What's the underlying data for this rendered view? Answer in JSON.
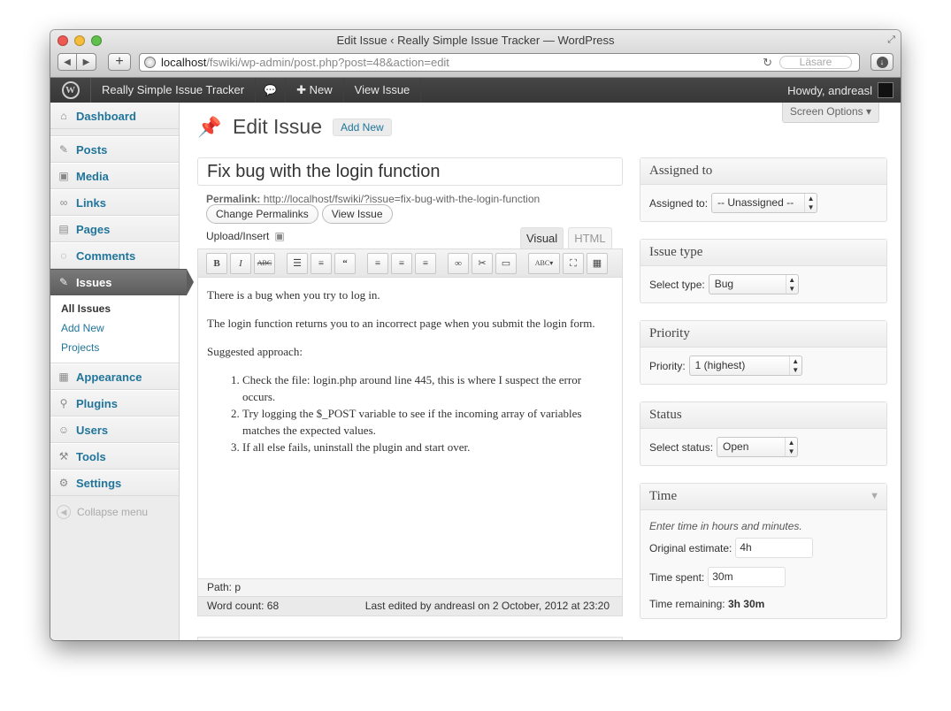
{
  "browser": {
    "window_title": "Edit Issue ‹ Really Simple Issue Tracker — WordPress",
    "url_host": "localhost",
    "url_path": "/fswiki/wp-admin/post.php?post=48&action=edit",
    "reader_label": "Läsare"
  },
  "adminbar": {
    "site_name": "Really Simple Issue Tracker",
    "new_label": "New",
    "view_label": "View Issue",
    "howdy": "Howdy, andreasl"
  },
  "sidebar": {
    "items": [
      {
        "label": "Dashboard",
        "icon": "dashboard-icon"
      },
      {
        "label": "Posts",
        "icon": "pin-icon"
      },
      {
        "label": "Media",
        "icon": "media-icon"
      },
      {
        "label": "Links",
        "icon": "link-icon"
      },
      {
        "label": "Pages",
        "icon": "page-icon"
      },
      {
        "label": "Comments",
        "icon": "comment-icon"
      },
      {
        "label": "Issues",
        "icon": "pin-icon"
      },
      {
        "label": "Appearance",
        "icon": "appearance-icon"
      },
      {
        "label": "Plugins",
        "icon": "plugin-icon"
      },
      {
        "label": "Users",
        "icon": "users-icon"
      },
      {
        "label": "Tools",
        "icon": "tools-icon"
      },
      {
        "label": "Settings",
        "icon": "settings-icon"
      }
    ],
    "submenu": [
      "All Issues",
      "Add New",
      "Projects"
    ],
    "collapse": "Collapse menu"
  },
  "page": {
    "screen_options": "Screen Options",
    "heading": "Edit Issue",
    "add_new": "Add New",
    "title": "Fix bug with the login function",
    "permalink_label": "Permalink:",
    "permalink_url": "http://localhost/fswiki/?issue=fix-bug-with-the-login-function",
    "change_permalinks": "Change Permalinks",
    "view_issue": "View Issue",
    "upload_insert": "Upload/Insert",
    "tab_visual": "Visual",
    "tab_html": "HTML"
  },
  "editor": {
    "p1": "There is a bug when you try to log in.",
    "p2": "The login function returns you to an incorrect page when you submit the login form.",
    "p3": "Suggested approach:",
    "list": [
      "Check the file: login.php around line 445, this is where I suspect the error occurs.",
      "Try logging the $_POST variable to see if the incoming array of variables matches the expected values.",
      "If all else fails, uninstall the plugin and start over."
    ],
    "path_label": "Path:",
    "path_value": "p",
    "word_count": "Word count: 68",
    "last_edited": "Last edited by andreasl on 2 October, 2012 at 23:20"
  },
  "boxes": {
    "assigned": {
      "title": "Assigned to",
      "label": "Assigned to:",
      "value": "-- Unassigned --"
    },
    "type": {
      "title": "Issue type",
      "label": "Select type:",
      "value": "Bug"
    },
    "priority": {
      "title": "Priority",
      "label": "Priority:",
      "value": "1 (highest)"
    },
    "status": {
      "title": "Status",
      "label": "Select status:",
      "value": "Open"
    },
    "time": {
      "title": "Time",
      "note": "Enter time in hours and minutes.",
      "orig_label": "Original estimate:",
      "orig_value": "4h",
      "spent_label": "Time spent:",
      "spent_value": "30m",
      "remaining_label": "Time remaining:",
      "remaining_value": "3h 30m"
    }
  }
}
